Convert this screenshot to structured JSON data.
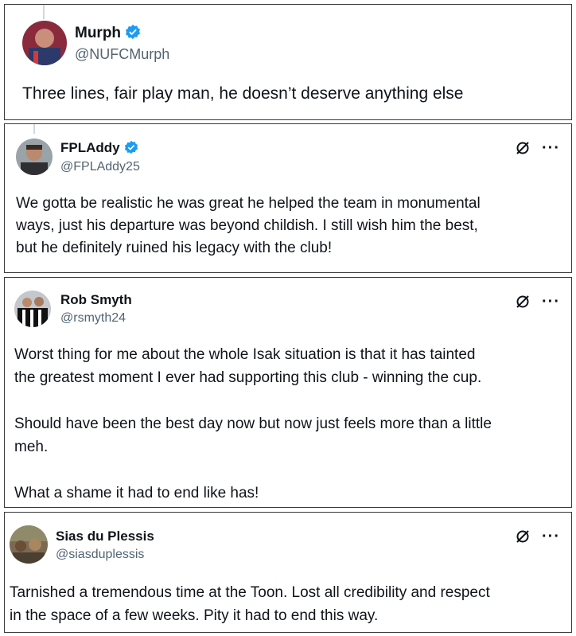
{
  "tweets": [
    {
      "name": "Murph",
      "handle": "@NUFCMurph",
      "verified": true,
      "text": "Three lines, fair play man, he doesn’t deserve anything else"
    },
    {
      "name": "FPLAddy",
      "handle": "@FPLAddy25",
      "verified": true,
      "text": "We gotta be realistic he was great he helped the team in monumental\nways, just his departure was beyond childish. I still wish him the best,\nbut he definitely ruined his legacy with the club!"
    },
    {
      "name": "Rob Smyth",
      "handle": "@rsmyth24",
      "verified": false,
      "text": "Worst thing for me about the whole Isak situation is that it has tainted\nthe greatest moment I ever had supporting this club - winning the cup.\n\nShould have been the best day now but now just feels more than a little\nmeh.\n\nWhat a shame it had to end like has!"
    },
    {
      "name": "Sias du Plessis",
      "handle": "@siasduplessis",
      "verified": false,
      "text": "Tarnished a tremendous time at the Toon. Lost all credibility and respect\nin the space of a few weeks. Pity it had to end this way."
    }
  ],
  "menu_label": "···",
  "colors": {
    "verified": "#1d9bf0",
    "handle": "#536471",
    "border": "#3a3a3a"
  }
}
